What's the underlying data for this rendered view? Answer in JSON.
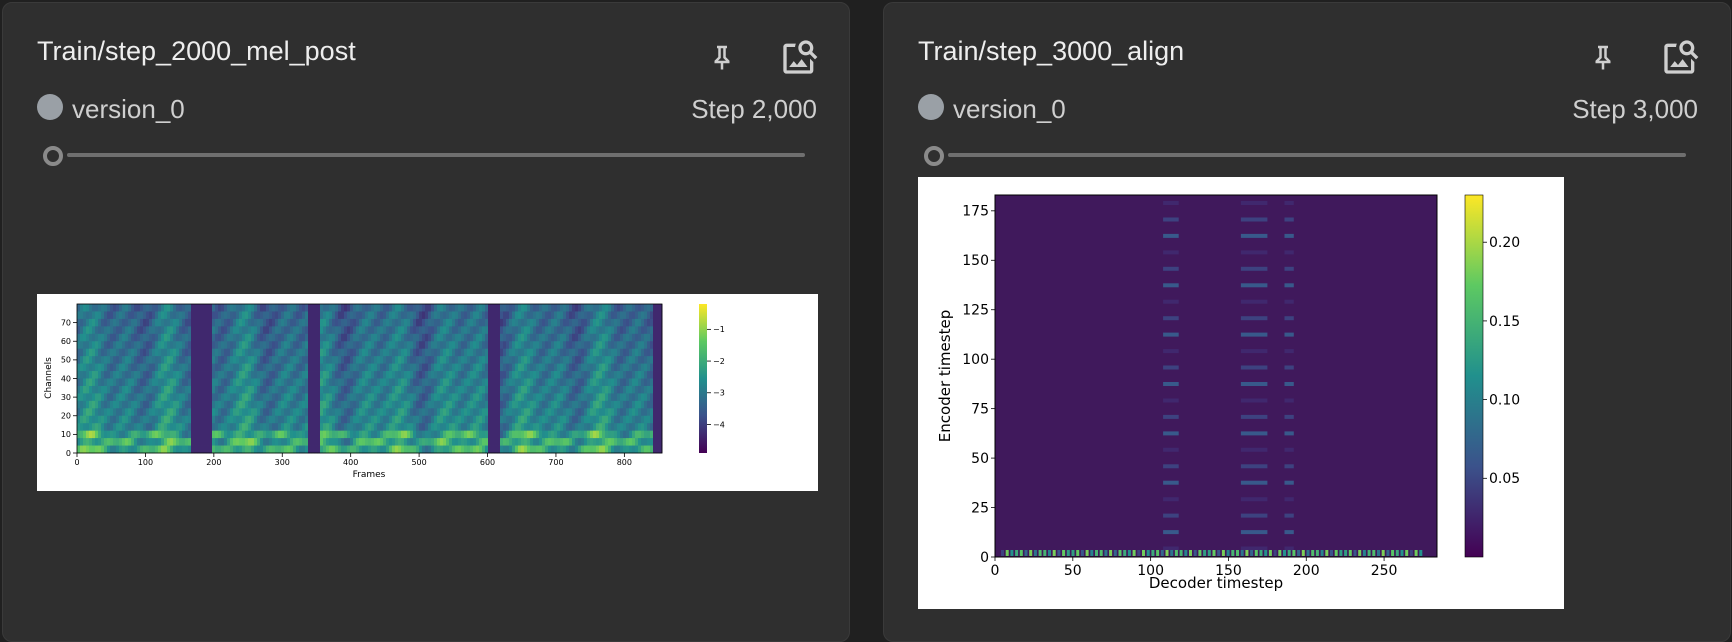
{
  "cards": [
    {
      "title": "Train/step_2000_mel_post",
      "run": "version_0",
      "step": "Step 2,000",
      "figure": {
        "type": "heatmap",
        "xlabel": "Frames",
        "ylabel": "Channels",
        "x_ticks": [
          "0",
          "100",
          "200",
          "300",
          "400",
          "500",
          "600",
          "700",
          "800"
        ],
        "y_ticks": [
          "0",
          "10",
          "20",
          "30",
          "40",
          "50",
          "60",
          "70"
        ],
        "colorbar_ticks": [
          "−1",
          "−2",
          "−3",
          "−4"
        ],
        "xlim": [
          0,
          855
        ],
        "ylim": [
          0,
          80
        ],
        "colorbar_range": [
          -4.9,
          -0.2
        ],
        "colormap": "viridis"
      }
    },
    {
      "title": "Train/step_3000_align",
      "run": "version_0",
      "step": "Step 3,000",
      "figure": {
        "type": "heatmap",
        "xlabel": "Decoder timestep",
        "ylabel": "Encoder timestep",
        "x_ticks": [
          "0",
          "50",
          "100",
          "150",
          "200",
          "250"
        ],
        "y_ticks": [
          "0",
          "25",
          "50",
          "75",
          "100",
          "125",
          "150",
          "175"
        ],
        "colorbar_ticks": [
          "0.05",
          "0.10",
          "0.15",
          "0.20"
        ],
        "xlim": [
          0,
          284
        ],
        "ylim": [
          0,
          183
        ],
        "colorbar_range": [
          0,
          0.23
        ],
        "colormap": "viridis"
      }
    }
  ],
  "icons": {
    "pin": "pin-icon",
    "zoom": "image-search-icon"
  },
  "colors": {
    "card_bg": "#2f2f2f",
    "page_bg": "#202020",
    "run_dot": "#9aa0a6",
    "slider": "#6f6f6f",
    "align_base": "#40195c"
  }
}
